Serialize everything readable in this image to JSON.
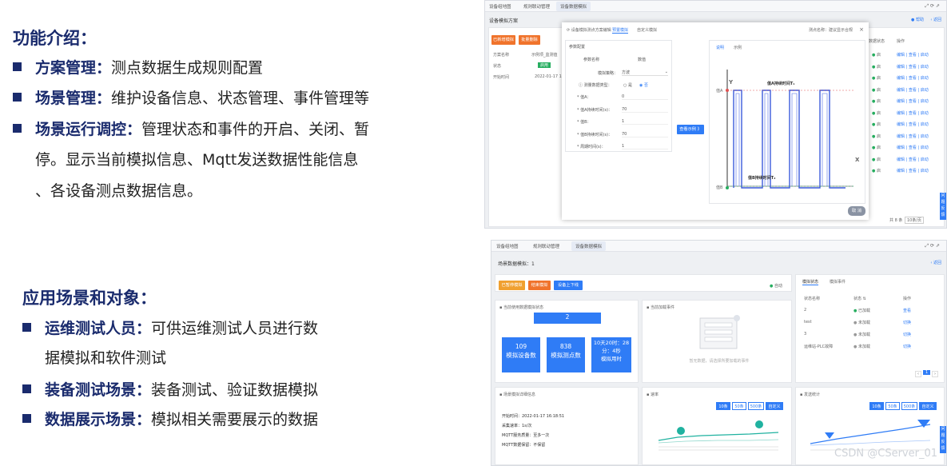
{
  "section1": {
    "heading": "功能介绍：",
    "items": [
      {
        "bold": "方案管理：",
        "text": "测点数据生成规则配置",
        "continuation": []
      },
      {
        "bold": "场景管理：",
        "text": "维护设备信息、状态管理、事件管理等",
        "continuation": []
      },
      {
        "bold": "场景运行调控：",
        "text": "管理状态和事件的开启、关闭、暂",
        "continuation": [
          "停。显示当前模拟信息、Mqtt发送数据性能信息",
          "、各设备测点数据信息。"
        ]
      }
    ]
  },
  "section2": {
    "heading": "应用场景和对象：",
    "items": [
      {
        "bold": "运维测试人员：",
        "text": "可供运维测试人员进行数",
        "continuation": [
          "据模拟和软件测试"
        ]
      },
      {
        "bold": "装备测试场景：",
        "text": "装备测试、验证数据模拟",
        "continuation": []
      },
      {
        "bold": "数据展示场景：",
        "text": "模拟相关需要展示的数据",
        "continuation": []
      }
    ]
  },
  "shot1": {
    "tabs": [
      "设备组地图",
      "规则联动管理",
      "设备数据模拟"
    ],
    "page_title": "设备模拟方案",
    "help": "帮助",
    "back": "返回",
    "buttons": {
      "add": "已新增模拟",
      "delete": "批量删除"
    },
    "left_table": {
      "rows": [
        {
          "label": "方案名称",
          "value": "示例项_监测值"
        },
        {
          "label": "状态",
          "value": "启用"
        },
        {
          "label": "开始时间",
          "value": "2022-01-17 1..."
        }
      ]
    },
    "right_cols": {
      "status": "数据状态",
      "op": "操作"
    },
    "right_rows": [
      [
        "启",
        "编辑 | 查看 | 启动"
      ],
      [
        "启",
        "编辑 | 查看 | 启动"
      ],
      [
        "启",
        "编辑 | 查看 | 启动"
      ],
      [
        "启",
        "编辑 | 查看 | 启动"
      ],
      [
        "启",
        "编辑 | 查看 | 启动"
      ],
      [
        "启",
        "编辑 | 查看 | 启动"
      ],
      [
        "启",
        "编辑 | 查看 | 启动"
      ],
      [
        "启",
        "编辑 | 查看 | 启动"
      ],
      [
        "启",
        "编辑 | 查看 | 启动"
      ],
      [
        "启",
        "编辑 | 查看 | 启动"
      ],
      [
        "启",
        "编辑 | 查看 | 启动"
      ]
    ],
    "pagination": {
      "total": "共 8 条",
      "page_size": "10条/页"
    },
    "side_tab": "问题反馈",
    "modal": {
      "breadcrumb": "设备模拟测点方案编辑",
      "tabs": [
        "预置模拟",
        "自定义模拟"
      ],
      "right_label": "测点名称：",
      "right_value": "建议显示合规",
      "config_title": "参数配置",
      "cols": [
        "参数名称",
        "数值"
      ],
      "mode_label": "模拟策略：",
      "mode_value": "方波",
      "data_type_label": "测量数据类型：",
      "radio_a": "是",
      "radio_b": "否",
      "fields": [
        {
          "label": "* 值A：",
          "value": "0"
        },
        {
          "label": "* 值A持续时间(s)：",
          "value": "70"
        },
        {
          "label": "* 值B：",
          "value": "1"
        },
        {
          "label": "* 值B持续时间(s)：",
          "value": "70"
        },
        {
          "label": "* 周期时间(s)：",
          "value": "1"
        }
      ],
      "preview_button": "查看示例 》",
      "preview_tabs": [
        "说明",
        "示例"
      ],
      "axis_y": "Y",
      "axis_x": "X",
      "value_a": "值A",
      "value_b": "值B",
      "dur_a": "值A持续时间T₁",
      "dur_b": "值B持续时间T₂",
      "cancel": "取 消"
    }
  },
  "shot2": {
    "tabs": [
      "设备组地图",
      "规则联动管理",
      "设备数据模拟"
    ],
    "title_label": "场景数据模拟：",
    "title_value": "1",
    "back": "返回",
    "buttons": [
      "已暂停模拟",
      "结束模拟",
      "设备上下线"
    ],
    "auto_label": "自动",
    "sim_status": {
      "title": "当前使用数据模拟状态",
      "count": "2",
      "stats": [
        {
          "value": "109",
          "label": "模拟设备数"
        },
        {
          "value": "838",
          "label": "模拟测点数"
        },
        {
          "value": "10天20时：28分：4秒",
          "label": "模拟用时"
        }
      ]
    },
    "events": {
      "title": "当前加载事件",
      "empty_text": "暂无数据，请选择所要加载的事件"
    },
    "right_tabs": [
      "模拟状态",
      "模拟事件"
    ],
    "table_cols": [
      "状态名称",
      "状态",
      "操作"
    ],
    "table_rows": [
      {
        "name": "2",
        "status": "已加载",
        "op": "查看",
        "color": "#27ae60"
      },
      {
        "name": "test",
        "status": "未加载",
        "op": "切换",
        "color": "#999999"
      },
      {
        "name": "3",
        "status": "未加载",
        "op": "切换",
        "color": "#999999"
      },
      {
        "name": "运维站-PLC故障",
        "status": "未加载",
        "op": "切换",
        "color": "#999999"
      }
    ],
    "page_num": "1",
    "detail": {
      "title": "场景模拟详细信息",
      "lines": [
        "开始时间：2022-01-17 16:18:51",
        "采集速率：1s/次",
        "MQTT服务质量：至多一次",
        "MQTT数据保留：不保留"
      ]
    },
    "speed": {
      "title": "速率",
      "segs": [
        "10条",
        "50条",
        "500条",
        "自定义"
      ]
    },
    "sent": {
      "title": "发送统计",
      "segs": [
        "10条",
        "50条",
        "500条",
        "自定义"
      ]
    },
    "side_tab": "问题反馈",
    "colors": {
      "blue": "#2f7cf6",
      "orange": "#f0732b",
      "green": "#27ae60",
      "teal": "#20b2a0"
    }
  },
  "watermark": "CSDN @CServer_01"
}
